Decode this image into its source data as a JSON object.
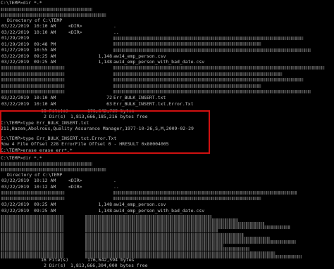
{
  "terminal": {
    "cmd1": "C:\\TEMP>dir *.*",
    "dir_header1": "Directory of C:\\TEMP",
    "listing1": [
      {
        "date": "03/22/2019",
        "time": "10:10 AM",
        "dir": "<DIR>",
        "size": "",
        "name": "."
      },
      {
        "date": "03/22/2019",
        "time": "10:10 AM",
        "dir": "<DIR>",
        "size": "",
        "name": ".."
      },
      {
        "date": "01/29/2019",
        "time": "",
        "dir": "",
        "size": "",
        "name": ""
      },
      {
        "date": "01/29/2019",
        "time": "09:48 PM",
        "dir": "",
        "size": "",
        "name": ""
      },
      {
        "date": "01/27/2019",
        "time": "10:55 AM",
        "dir": "",
        "size": "",
        "name": ""
      },
      {
        "date": "03/22/2019",
        "time": "09:25 AM",
        "dir": "",
        "size": "1,148",
        "name": "aw14_emp_person.csv"
      },
      {
        "date": "03/22/2019",
        "time": "09:25 AM",
        "dir": "",
        "size": "1,148",
        "name": "aw14_emp_person_with_bad_date.csv"
      },
      {
        "date": "",
        "time": "",
        "dir": "",
        "size": "",
        "name": ""
      },
      {
        "date": "",
        "time": "",
        "dir": "",
        "size": "",
        "name": ""
      },
      {
        "date": "",
        "time": "",
        "dir": "",
        "size": "",
        "name": ""
      },
      {
        "date": "",
        "time": "",
        "dir": "",
        "size": "",
        "name": ""
      },
      {
        "date": "",
        "time": "",
        "dir": "",
        "size": "",
        "name": ""
      },
      {
        "date": "03/22/2019",
        "time": "10:10 AM",
        "dir": "",
        "size": "72",
        "name": "Err_BULK_INSERT.txt"
      },
      {
        "date": "03/22/2019",
        "time": "10:10 AM",
        "dir": "",
        "size": "63",
        "name": "Err_BULK_INSERT.txt.Error.Txt"
      }
    ],
    "summary1_files": "18 File(s)",
    "summary1_bytes": "176,642,729 bytes",
    "summary1_dirs": "2 Dir(s)",
    "summary1_free": "1,813,666,185,216 bytes free",
    "cmd2": "C:\\TEMP>type Err_BULK_INSERT.txt",
    "out2": "211,Hazem,Abolrous,Quality Assurance Manager,1977-10-26,S,M,2009-02-29",
    "cmd3": "C:\\TEMP>type Err_BULK_INSERT.txt.Error.Txt",
    "out3": "Row 4 File Offset 228 ErrorFile Offset 0 - HRESULT 0x80004005",
    "cmd4": "C:\\TEMP>erase erase err*.*",
    "cmd5": "C:\\TEMP>dir *.*",
    "dir_header2": "Directory of C:\\TEMP",
    "listing2": [
      {
        "date": "03/22/2019",
        "time": "10:12 AM",
        "dir": "<DIR>",
        "size": "",
        "name": "."
      },
      {
        "date": "03/22/2019",
        "time": "10:12 AM",
        "dir": "<DIR>",
        "size": "",
        "name": ".."
      },
      {
        "date": "",
        "time": "",
        "dir": "",
        "size": "",
        "name": ""
      },
      {
        "date": "",
        "time": "",
        "dir": "",
        "size": "",
        "name": ""
      },
      {
        "date": "03/22/2019",
        "time": "09:25 AM",
        "dir": "",
        "size": "1,148",
        "name": "aw14_emp_person.csv"
      },
      {
        "date": "03/22/2019",
        "time": "09:25 AM",
        "dir": "",
        "size": "1,148",
        "name": "aw14_emp_person_with_bad_date.csv"
      }
    ],
    "summary2_files": "16 File(s)",
    "summary2_bytes": "176,642,594 bytes",
    "summary2_dirs": "2 Dir(s)",
    "summary2_free": "1,813,666,304,000 bytes free"
  }
}
